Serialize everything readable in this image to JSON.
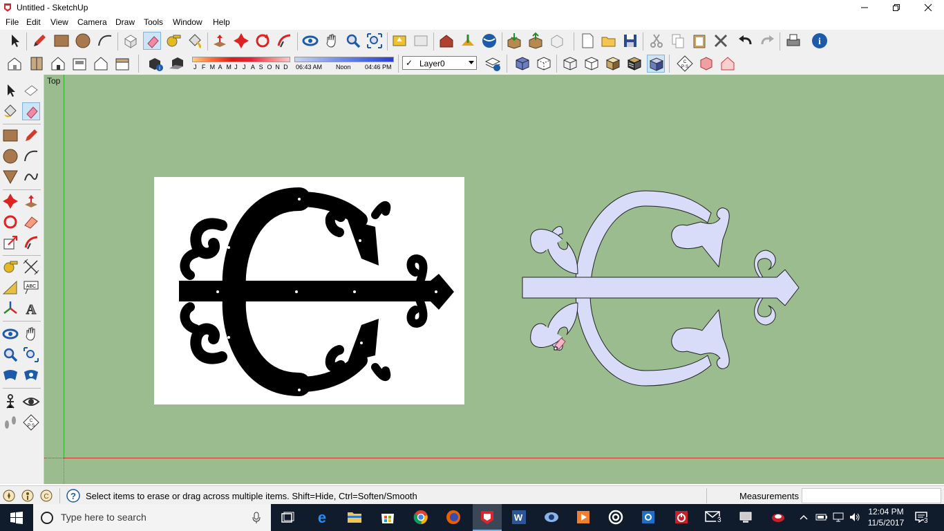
{
  "window": {
    "title": "Untitled - SketchUp",
    "minimize_icon": "minimize-icon",
    "maximize_icon": "restore-icon",
    "close_icon": "close-icon"
  },
  "menu": [
    "File",
    "Edit",
    "View",
    "Camera",
    "Draw",
    "Tools",
    "Window",
    "Help"
  ],
  "shadow_bar": {
    "months": [
      "J",
      "F",
      "M",
      "A",
      "M",
      "J",
      "J",
      "A",
      "S",
      "O",
      "N",
      "D"
    ],
    "time_start": "06:43 AM",
    "time_mid": "Noon",
    "time_end": "04:46 PM"
  },
  "layer_select": {
    "check": "✓",
    "value": "Layer0"
  },
  "viewport": {
    "view_name": "Top",
    "background": "#9bbc8f",
    "model_fill": "#d8dcf8"
  },
  "status": {
    "message": "Select items to erase or drag across multiple items. Shift=Hide, Ctrl=Soften/Smooth",
    "measurements_label": "Measurements",
    "measurements_value": ""
  },
  "taskbar": {
    "search_placeholder": "Type here to search",
    "time": "12:04 PM",
    "date": "11/5/2017",
    "mail_badge": "3",
    "notif_badge": "3"
  }
}
